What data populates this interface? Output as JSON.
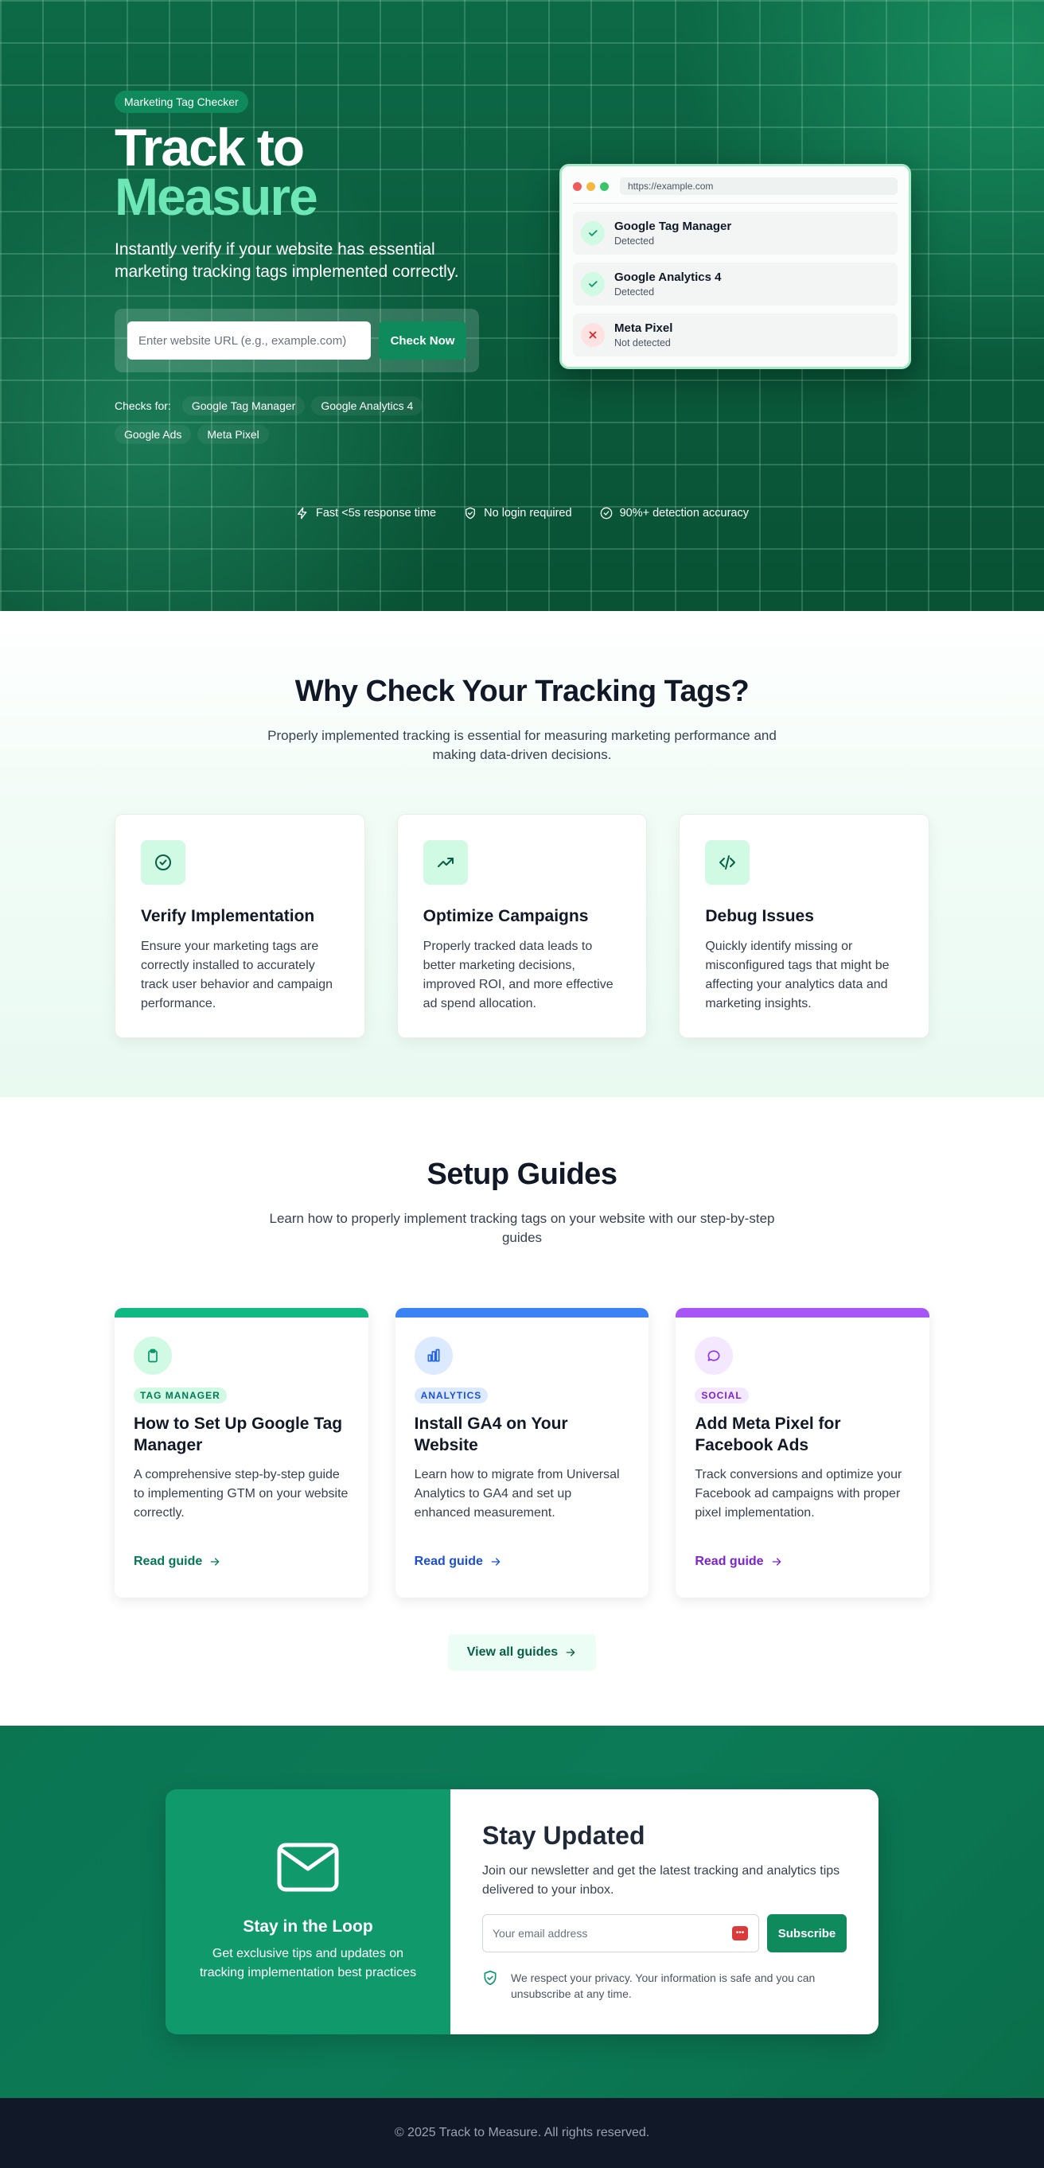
{
  "hero": {
    "badge": "Marketing Tag Checker",
    "title_line1": "Track to",
    "title_line2": "Measure",
    "subtitle": "Instantly verify if your website has essential marketing tracking tags implemented correctly.",
    "input_placeholder": "Enter website URL (e.g., example.com)",
    "check_button": "Check Now",
    "checks_label": "Checks for:",
    "check_chips": [
      "Google Tag Manager",
      "Google Analytics 4",
      "Google Ads",
      "Meta Pixel"
    ],
    "trust": [
      {
        "icon": "lightning-icon",
        "label": "Fast <5s response time"
      },
      {
        "icon": "shield-check-icon",
        "label": "No login required"
      },
      {
        "icon": "check-circle-icon",
        "label": "90%+ detection accuracy"
      }
    ]
  },
  "preview": {
    "address": "https://example.com",
    "rows": [
      {
        "name": "Google Tag Manager",
        "status": "Detected",
        "state": "ok"
      },
      {
        "name": "Google Analytics 4",
        "status": "Detected",
        "state": "ok"
      },
      {
        "name": "Meta Pixel",
        "status": "Not detected",
        "state": "bad"
      }
    ]
  },
  "why": {
    "title": "Why Check Your Tracking Tags?",
    "subtitle": "Properly implemented tracking is essential for measuring marketing performance and making data-driven decisions.",
    "cards": [
      {
        "icon": "check-circle-icon",
        "title": "Verify Implementation",
        "text": "Ensure your marketing tags are correctly installed to accurately track user behavior and campaign performance."
      },
      {
        "icon": "trending-up-icon",
        "title": "Optimize Campaigns",
        "text": "Properly tracked data leads to better marketing decisions, improved ROI, and more effective ad spend allocation."
      },
      {
        "icon": "code-icon",
        "title": "Debug Issues",
        "text": "Quickly identify missing or misconfigured tags that might be affecting your analytics data and marketing insights."
      }
    ]
  },
  "guides": {
    "title": "Setup Guides",
    "subtitle": "Learn how to properly implement tracking tags on your website with our step-by-step guides",
    "cards": [
      {
        "icon": "clipboard-icon",
        "tag": "TAG MANAGER",
        "title": "How to Set Up Google Tag Manager",
        "text": "A comprehensive step-by-step guide to implementing GTM on your website correctly.",
        "link": "Read guide",
        "accent": "#10b981"
      },
      {
        "icon": "bar-chart-icon",
        "tag": "ANALYTICS",
        "title": "Install GA4 on Your Website",
        "text": "Learn how to migrate from Universal Analytics to GA4 and set up enhanced measurement.",
        "link": "Read guide",
        "accent": "#3b82f6"
      },
      {
        "icon": "chat-icon",
        "tag": "SOCIAL",
        "title": "Add Meta Pixel for Facebook Ads",
        "text": "Track conversions and optimize your Facebook ad campaigns with proper pixel implementation.",
        "link": "Read guide",
        "accent": "#a855f7"
      }
    ],
    "view_all": "View all guides"
  },
  "newsletter": {
    "left_title": "Stay in the Loop",
    "left_text": "Get exclusive tips and updates on tracking implementation best practices",
    "title": "Stay Updated",
    "text": "Join our newsletter and get the latest tracking and analytics tips delivered to your inbox.",
    "email_placeholder": "Your email address",
    "subscribe": "Subscribe",
    "privacy": "We respect your privacy. Your information is safe and you can unsubscribe at any time."
  },
  "footer": {
    "copyright": "© 2025 Track to Measure. All rights reserved."
  }
}
